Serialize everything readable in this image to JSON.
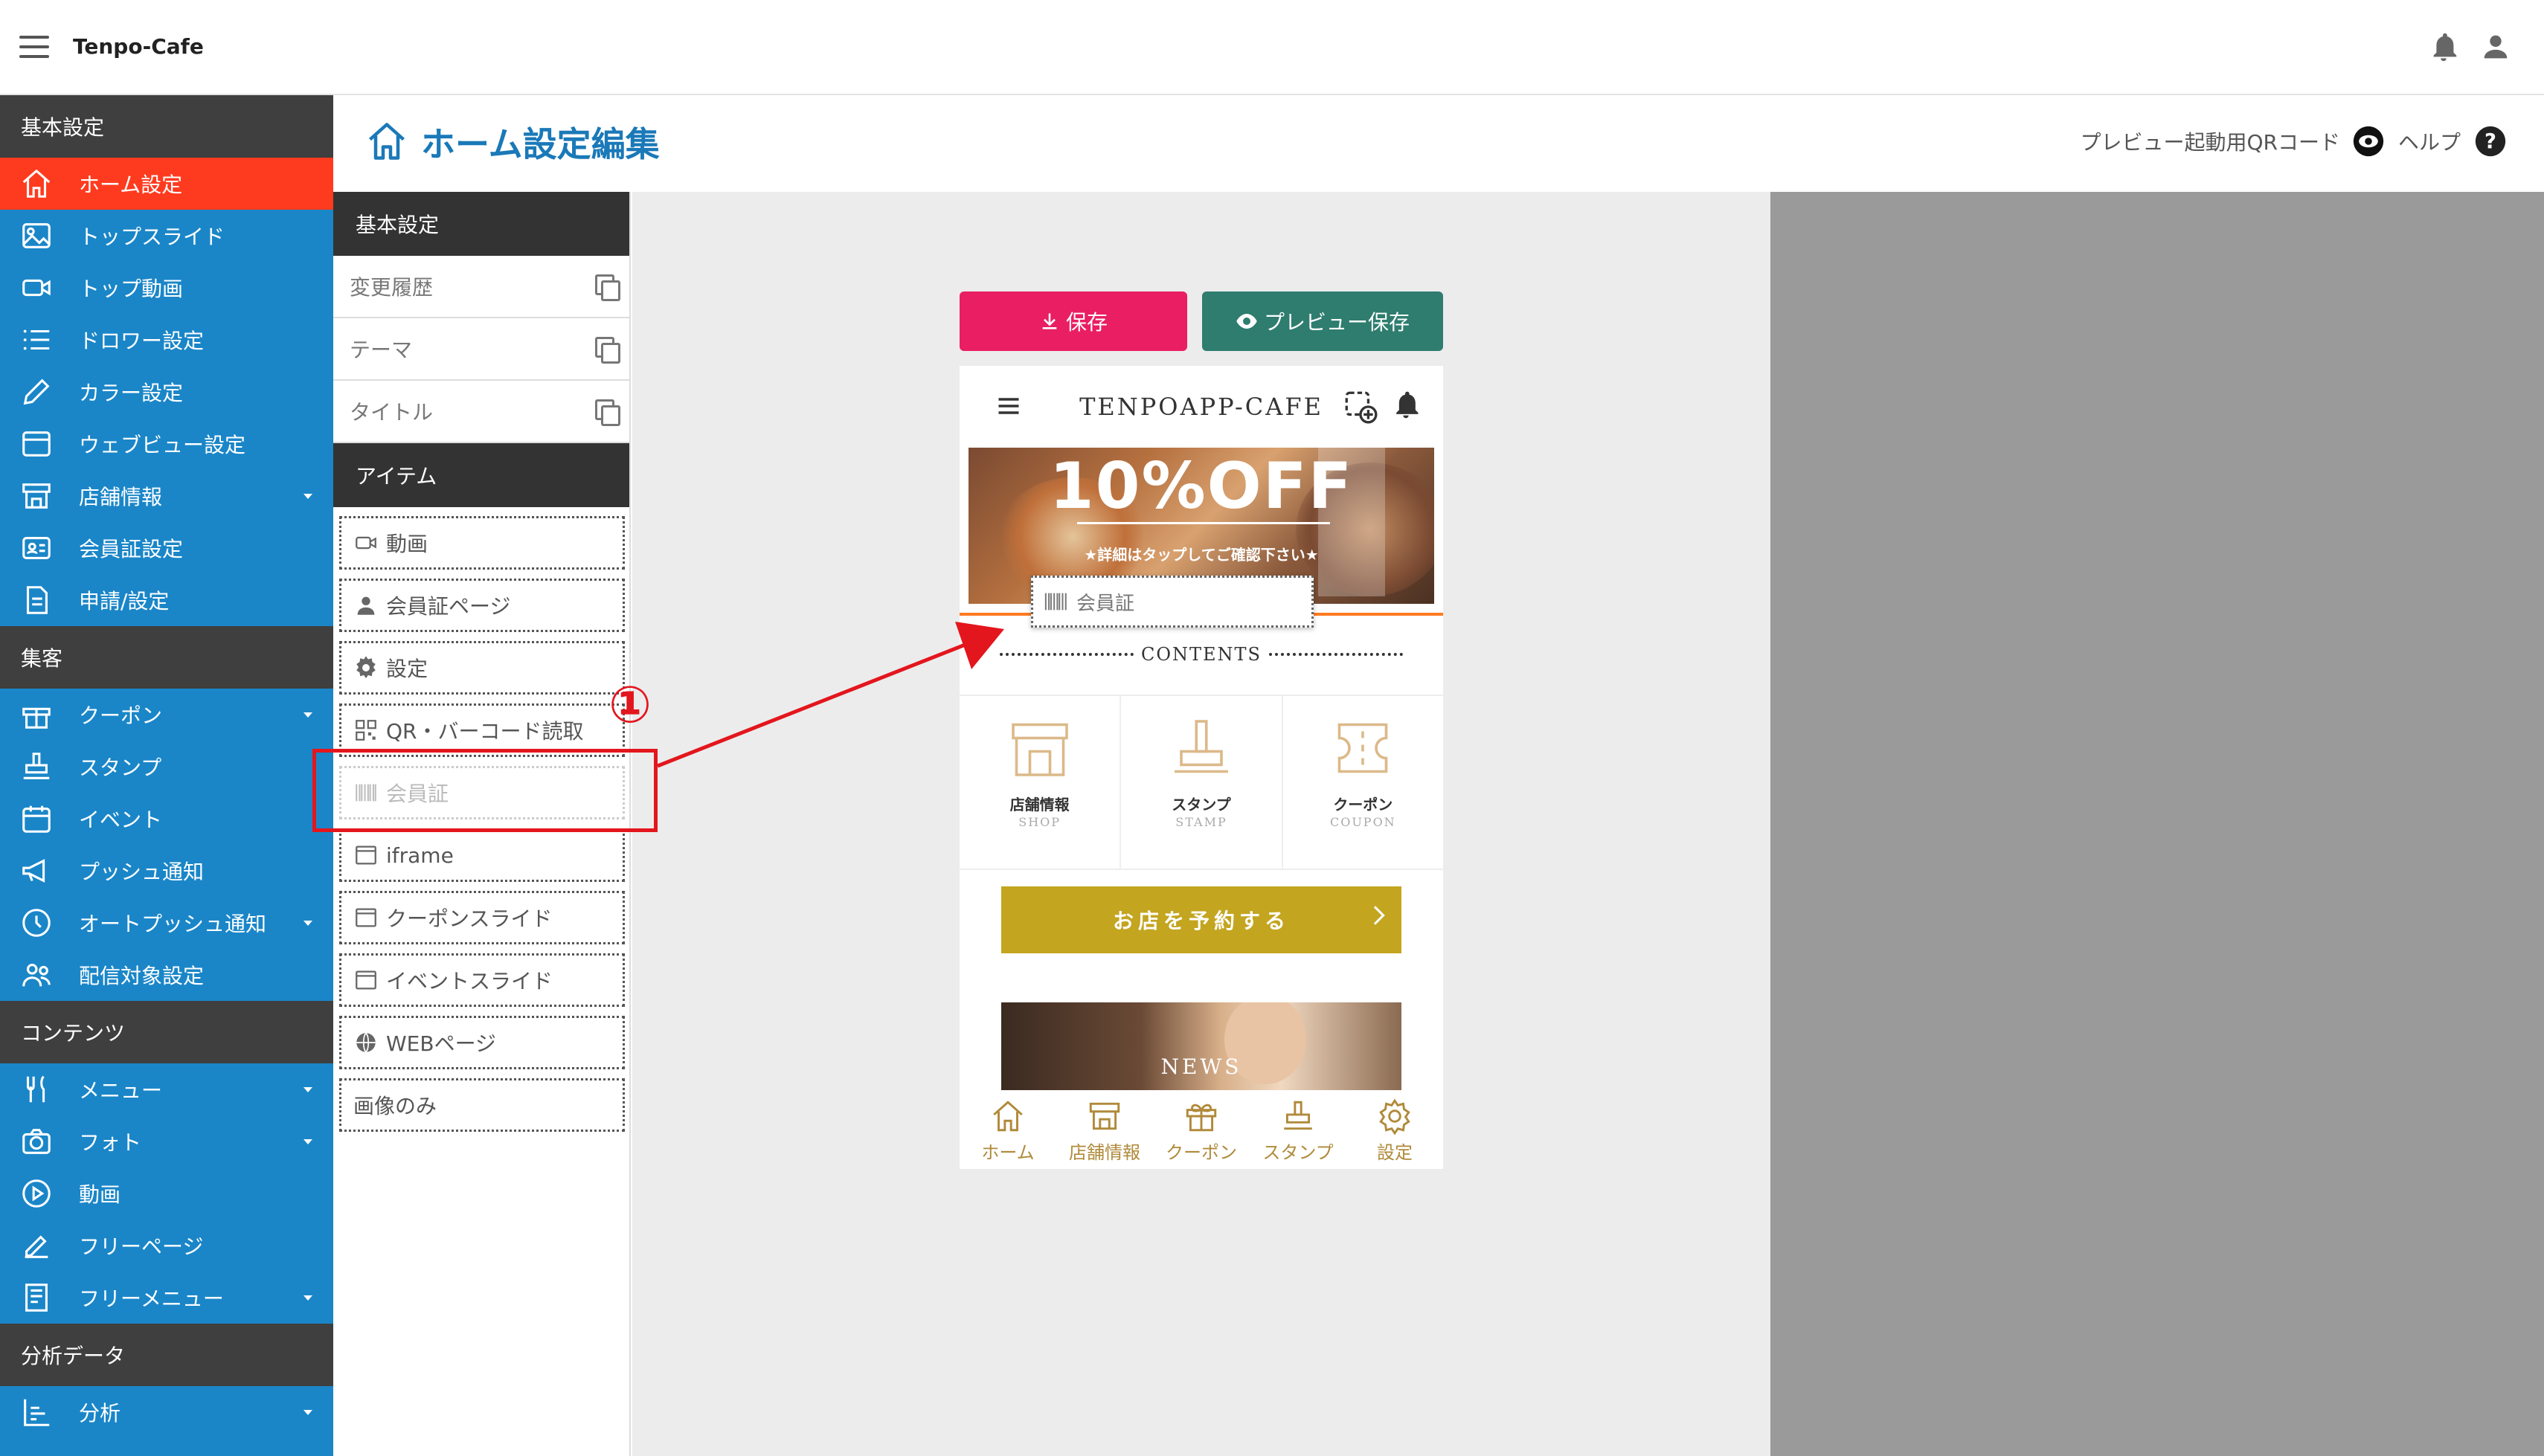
{
  "topbar": {
    "app_title": "Tenpo-Cafe"
  },
  "sidebar": {
    "sections": [
      {
        "title": "基本設定",
        "items": [
          {
            "label": "ホーム設定",
            "icon": "home-icon",
            "active": true
          },
          {
            "label": "トップスライド",
            "icon": "image-icon"
          },
          {
            "label": "トップ動画",
            "icon": "video-icon"
          },
          {
            "label": "ドロワー設定",
            "icon": "list-icon"
          },
          {
            "label": "カラー設定",
            "icon": "pencil-icon"
          },
          {
            "label": "ウェブビュー設定",
            "icon": "browser-icon"
          },
          {
            "label": "店舗情報",
            "icon": "store-icon",
            "caret": true
          },
          {
            "label": "会員証設定",
            "icon": "id-card-icon"
          },
          {
            "label": "申請/設定",
            "icon": "document-icon"
          }
        ]
      },
      {
        "title": "集客",
        "items": [
          {
            "label": "クーポン",
            "icon": "gift-icon",
            "caret": true
          },
          {
            "label": "スタンプ",
            "icon": "stamp-icon"
          },
          {
            "label": "イベント",
            "icon": "calendar-icon"
          },
          {
            "label": "プッシュ通知",
            "icon": "megaphone-icon"
          },
          {
            "label": "オートプッシュ通知",
            "icon": "clock-icon",
            "caret": true
          },
          {
            "label": "配信対象設定",
            "icon": "users-icon"
          }
        ]
      },
      {
        "title": "コンテンツ",
        "items": [
          {
            "label": "メニュー",
            "icon": "fork-knife-icon",
            "caret": true
          },
          {
            "label": "フォト",
            "icon": "camera-icon",
            "caret": true
          },
          {
            "label": "動画",
            "icon": "play-icon"
          },
          {
            "label": "フリーページ",
            "icon": "edit-icon"
          },
          {
            "label": "フリーメニュー",
            "icon": "book-icon",
            "caret": true
          }
        ]
      },
      {
        "title": "分析データ",
        "items": [
          {
            "label": "分析",
            "icon": "bar-chart-icon",
            "caret": true
          }
        ]
      }
    ]
  },
  "header": {
    "title": "ホーム設定編集",
    "qr_label": "プレビュー起動用QRコード",
    "help_label": "ヘルプ"
  },
  "midpanel": {
    "basic_title": "基本設定",
    "basic_rows": [
      "変更履歴",
      "テーマ",
      "タイトル"
    ],
    "items_title": "アイテム",
    "items": [
      {
        "label": "動画",
        "icon": "video-icon"
      },
      {
        "label": "会員証ページ",
        "icon": "person-icon"
      },
      {
        "label": "設定",
        "icon": "gear-icon"
      },
      {
        "label": "QR・バーコード読取",
        "icon": "qr-icon"
      },
      {
        "label": "会員証",
        "icon": "barcode-icon",
        "ghost": true
      },
      {
        "label": "iframe",
        "icon": "window-icon"
      },
      {
        "label": "クーポンスライド",
        "icon": "window-icon"
      },
      {
        "label": "イベントスライド",
        "icon": "window-icon"
      },
      {
        "label": "WEBページ",
        "icon": "globe-icon"
      },
      {
        "label": "画像のみ",
        "icon": ""
      }
    ]
  },
  "buttons": {
    "save": "保存",
    "preview_save": "プレビュー保存"
  },
  "phone": {
    "title": "TENPOAPP-CAFE",
    "banner_title": "10%OFF",
    "banner_sub": "★詳細はタップしてご確認下さい★",
    "drag_chip": "会員証",
    "contents_label": "CONTENTS",
    "tiles": [
      {
        "jp": "店舗情報",
        "en": "SHOP"
      },
      {
        "jp": "スタンプ",
        "en": "STAMP"
      },
      {
        "jp": "クーポン",
        "en": "COUPON"
      }
    ],
    "reserve_label": "お店を予約する",
    "news_label": "NEWS",
    "tabs": [
      "ホーム",
      "店舗情報",
      "クーポン",
      "スタンプ",
      "設定"
    ]
  },
  "annotation": {
    "number": "①"
  },
  "colors": {
    "sidebar": "#1a86c8",
    "active": "#ff3b1f",
    "save": "#e91e63",
    "preview": "#2e7d6f",
    "gold": "#c3a520",
    "annotation": "#e3161d"
  }
}
